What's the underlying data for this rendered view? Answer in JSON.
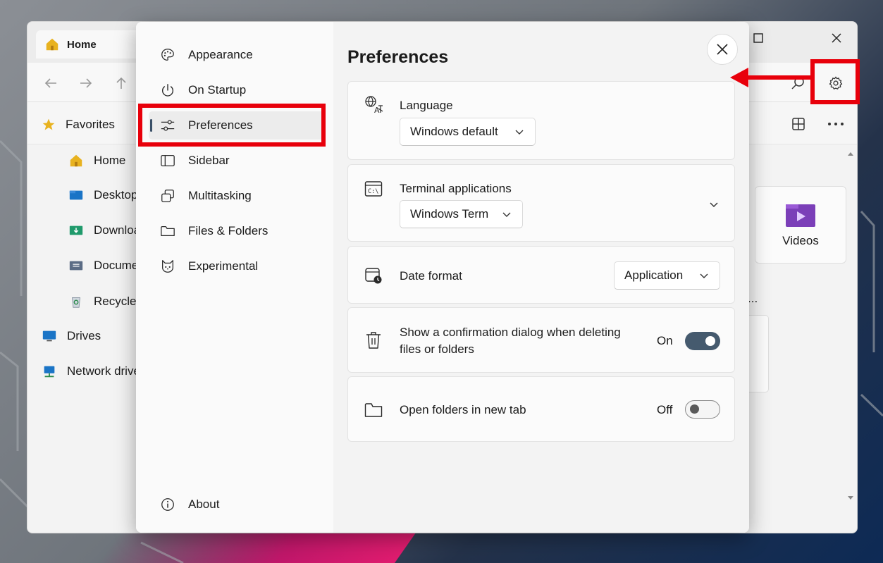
{
  "explorer": {
    "tab_title": "Home",
    "sidebar": [
      {
        "label": "Favorites",
        "icon": "star-icon"
      },
      {
        "label": "Home",
        "icon": "home-icon"
      },
      {
        "label": "Desktop",
        "icon": "desktop-folder-icon"
      },
      {
        "label": "Downloads",
        "icon": "downloads-folder-icon"
      },
      {
        "label": "Documents",
        "icon": "documents-folder-icon"
      },
      {
        "label": "Recycle Bin",
        "icon": "recycle-bin-icon"
      },
      {
        "label": "Drives",
        "icon": "drives-icon"
      },
      {
        "label": "Network drives",
        "icon": "network-drive-icon"
      }
    ],
    "content_card": {
      "label": "Videos",
      "icon": "videos-folder-icon"
    },
    "more_label": "..."
  },
  "dialog": {
    "title": "Preferences",
    "nav": [
      {
        "label": "Appearance",
        "icon": "palette-icon"
      },
      {
        "label": "On Startup",
        "icon": "power-icon"
      },
      {
        "label": "Preferences",
        "icon": "sliders-icon",
        "selected": true
      },
      {
        "label": "Sidebar",
        "icon": "sidebar-icon"
      },
      {
        "label": "Multitasking",
        "icon": "multitasking-icon"
      },
      {
        "label": "Files & Folders",
        "icon": "folder-icon"
      },
      {
        "label": "Experimental",
        "icon": "cat-icon"
      }
    ],
    "about_label": "About",
    "settings": {
      "language": {
        "label": "Language",
        "value": "Windows default"
      },
      "terminal": {
        "label": "Terminal applications",
        "value": "Windows Term"
      },
      "date_format": {
        "label": "Date format",
        "value": "Application"
      },
      "confirm_delete": {
        "label_line1": "Show a confirmation dialog when deleting",
        "label_line2": "files or folders",
        "state": "On",
        "enabled": true
      },
      "open_new_tab": {
        "label": "Open folders in new tab",
        "state": "Off",
        "enabled": false
      }
    }
  },
  "colors": {
    "highlight": "#e8000b",
    "toggle_on": "#455a6e"
  }
}
